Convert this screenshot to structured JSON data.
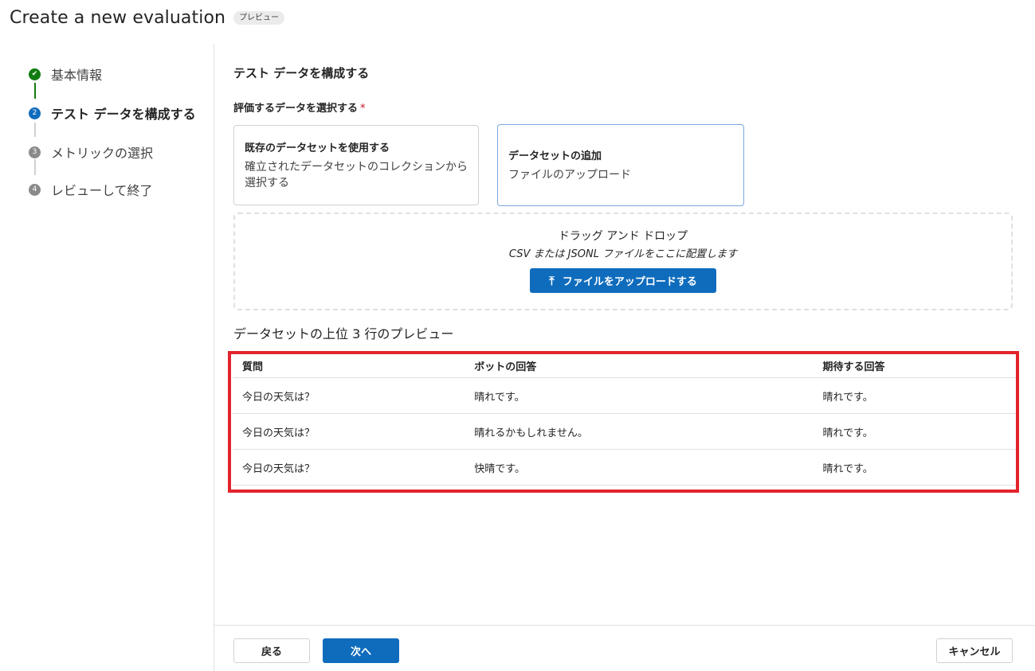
{
  "header": {
    "title": "Create a new evaluation",
    "badge": "プレビュー"
  },
  "stepper": {
    "steps": [
      {
        "number": "1",
        "label": "基本情報",
        "state": "done"
      },
      {
        "number": "2",
        "label": "テスト データを構成する",
        "state": "current"
      },
      {
        "number": "3",
        "label": "メトリックの選択",
        "state": "pending"
      },
      {
        "number": "4",
        "label": "レビューして終了",
        "state": "pending"
      }
    ]
  },
  "main": {
    "section_title": "テスト データを構成する",
    "field_label": "評価するデータを選択する",
    "required_marker": "*",
    "options": [
      {
        "title": "既存のデータセットを使用する",
        "desc": "確立されたデータセットのコレクションから選択する"
      },
      {
        "title": "データセットの追加",
        "desc": "ファイルのアップロード"
      }
    ],
    "dropzone": {
      "title": "ドラッグ アンド ドロップ",
      "subtitle": "CSV または JSONL ファイルをここに配置します",
      "upload_label": "ファイルをアップロードする",
      "upload_icon": "upload-arrow-icon"
    },
    "preview_label": "データセットの上位 3 行のプレビュー",
    "table": {
      "headers": [
        "質問",
        "ボットの回答",
        "期待する回答"
      ],
      "rows": [
        [
          "今日の天気は？",
          "晴れです。",
          "晴れです。"
        ],
        [
          "今日の天気は？",
          "晴れるかもしれません。",
          "晴れです。"
        ],
        [
          "今日の天気は？",
          "快晴です。",
          "晴れです。"
        ]
      ]
    }
  },
  "footer": {
    "back_label": "戻る",
    "next_label": "次へ",
    "cancel_label": "キャンセル"
  },
  "colors": {
    "accent": "#0f6cbd",
    "done": "#107c10",
    "highlight": "#e3232b"
  }
}
